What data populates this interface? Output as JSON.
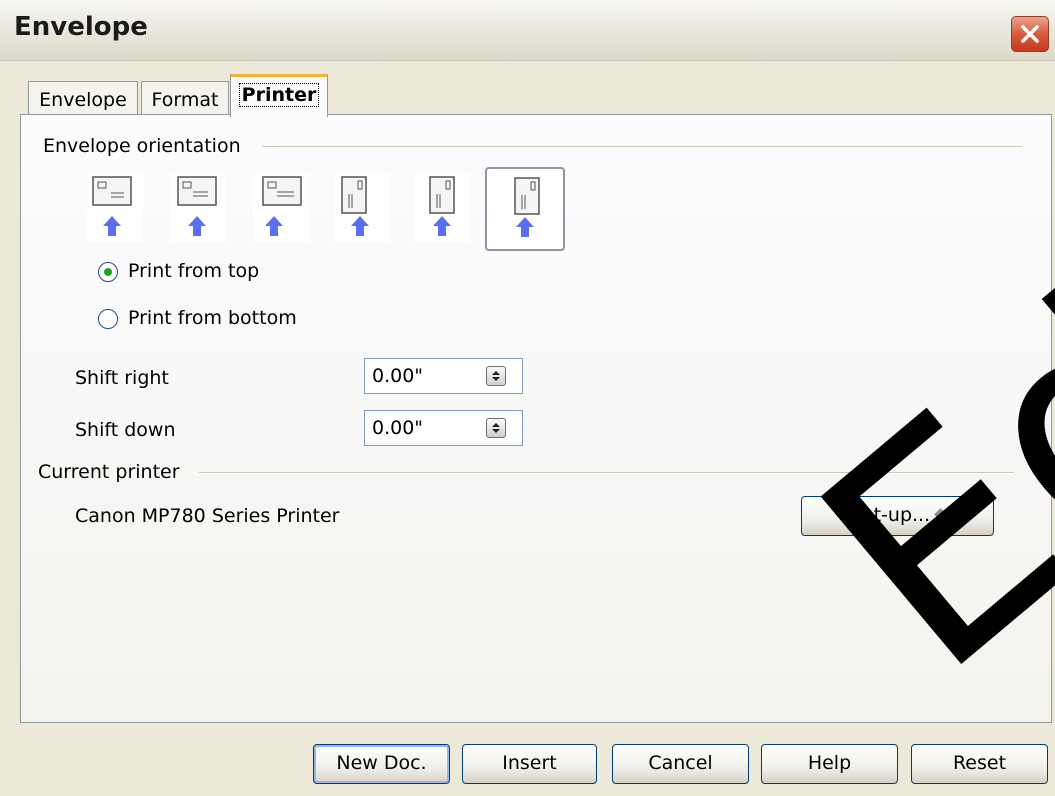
{
  "window": {
    "title": "Envelope"
  },
  "tabs": [
    {
      "label": "Envelope",
      "active": false
    },
    {
      "label": "Format",
      "active": false
    },
    {
      "label": "Printer",
      "active": true
    }
  ],
  "orientation_group": {
    "label": "Envelope orientation",
    "selected_index": 5,
    "options": [
      {
        "icon": "envelope-horizontal-icon"
      },
      {
        "icon": "envelope-horizontal-icon"
      },
      {
        "icon": "envelope-horizontal-icon"
      },
      {
        "icon": "envelope-vertical-icon"
      },
      {
        "icon": "envelope-vertical-icon"
      },
      {
        "icon": "envelope-vertical-icon"
      }
    ]
  },
  "print_from": {
    "top": {
      "label": "Print from top",
      "checked": true
    },
    "bottom": {
      "label": "Print from bottom",
      "checked": false
    }
  },
  "shift_right": {
    "label": "Shift right",
    "value": "0.00\""
  },
  "shift_down": {
    "label": "Shift down",
    "value": "0.00\""
  },
  "current_printer": {
    "label": "Current printer",
    "name": "Canon MP780 Series Printer",
    "setup_label": "Set-up..."
  },
  "buttons": {
    "new_doc": "New Doc.",
    "insert": "Insert",
    "cancel": "Cancel",
    "help": "Help",
    "reset": "Reset"
  },
  "watermark": "Edition",
  "colors": {
    "accent_tab": "#f2b23a",
    "radio_dot": "#21a121",
    "arrow": "#5a6ff0",
    "close": "#d85c3e"
  }
}
